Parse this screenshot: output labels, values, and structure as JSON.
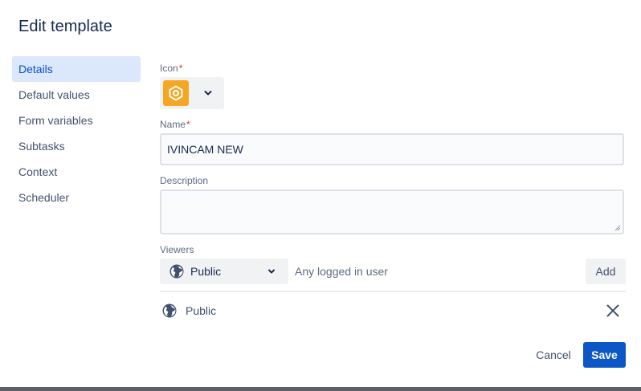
{
  "dialog": {
    "title": "Edit template"
  },
  "nav": {
    "items": [
      {
        "label": "Details",
        "active": true
      },
      {
        "label": "Default values"
      },
      {
        "label": "Form variables"
      },
      {
        "label": "Subtasks"
      },
      {
        "label": "Context"
      },
      {
        "label": "Scheduler"
      }
    ]
  },
  "form": {
    "icon": {
      "label": "Icon",
      "required_mark": "*",
      "selected_icon": "hexagon-icon",
      "tile_color": "#f5a623"
    },
    "name": {
      "label": "Name",
      "required_mark": "*",
      "value": "IVINCAM NEW"
    },
    "description": {
      "label": "Description",
      "value": ""
    },
    "viewers": {
      "label": "Viewers",
      "select_value": "Public",
      "hint": "Any logged in user",
      "add_label": "Add",
      "list": [
        {
          "label": "Public",
          "icon": "globe-icon"
        }
      ]
    }
  },
  "footer": {
    "cancel_label": "Cancel",
    "save_label": "Save"
  },
  "colors": {
    "accent": "#0c57c6",
    "nav_active_bg": "#dbe7fb",
    "required": "#de350b"
  }
}
